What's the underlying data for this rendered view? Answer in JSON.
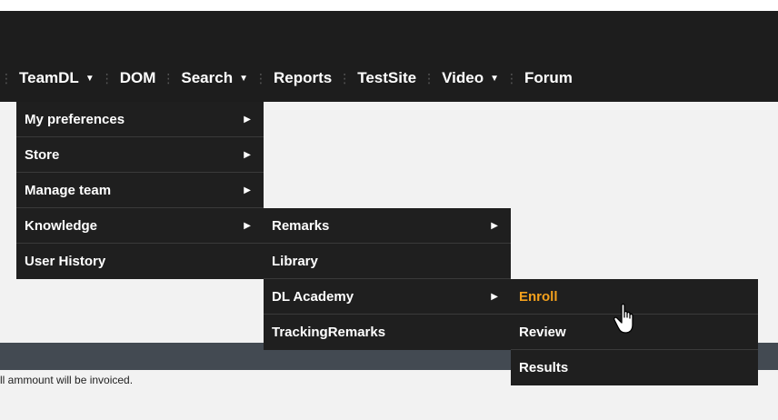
{
  "nav": {
    "items": [
      {
        "label": "TeamDL",
        "dropdown": true
      },
      {
        "label": "DOM",
        "dropdown": false
      },
      {
        "label": "Search",
        "dropdown": true
      },
      {
        "label": "Reports",
        "dropdown": false
      },
      {
        "label": "TestSite",
        "dropdown": false
      },
      {
        "label": "Video",
        "dropdown": true
      },
      {
        "label": "Forum",
        "dropdown": false
      }
    ]
  },
  "menus": {
    "teamdl": [
      "My preferences",
      "Store",
      "Manage team",
      "Knowledge",
      "User History"
    ],
    "knowledge": [
      "Remarks",
      "Library",
      "DL Academy",
      "TrackingRemarks"
    ],
    "academy": [
      "Enroll",
      "Review",
      "Results"
    ]
  },
  "footer": {
    "text": "ll ammount will be invoiced."
  },
  "colors": {
    "highlight": "#f4a11d",
    "menu_bg": "#1f1f1f",
    "navbar_bg": "#1d1d1d"
  }
}
